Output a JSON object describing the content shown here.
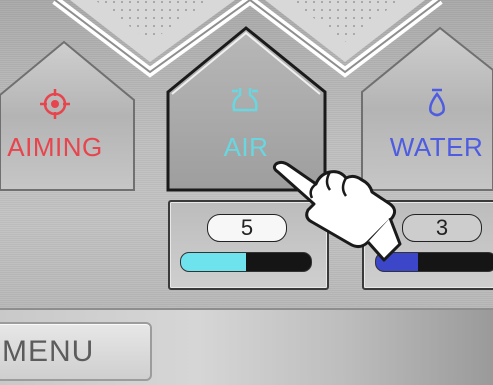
{
  "tiles": [
    {
      "id": "aiming",
      "label": "AIMING",
      "icon": "crosshair-icon",
      "color": "#e8444d"
    },
    {
      "id": "air",
      "label": "AIR",
      "icon": "air-nozzle-icon",
      "color": "#68d7e0"
    },
    {
      "id": "water",
      "label": "WATER",
      "icon": "water-drop-icon",
      "color": "#4d5ce0"
    }
  ],
  "air_setting": {
    "value": "5",
    "level": 0.5,
    "color": "#6ee3ee"
  },
  "water_setting": {
    "value": "3",
    "level": 0.35,
    "color": "#3c46c8"
  },
  "menu": {
    "label": "MENU"
  }
}
